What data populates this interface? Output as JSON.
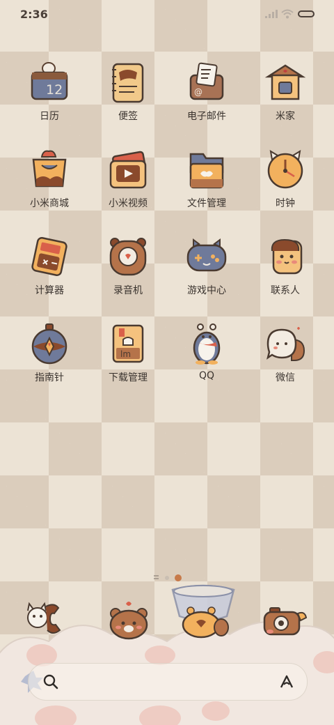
{
  "status_bar": {
    "time": "2:36"
  },
  "apps": [
    {
      "label": "日历",
      "icon": "calendar-icon",
      "day": "12"
    },
    {
      "label": "便签",
      "icon": "notes-icon"
    },
    {
      "label": "电子邮件",
      "icon": "email-icon"
    },
    {
      "label": "米家",
      "icon": "mijia-house-icon"
    },
    {
      "label": "小米商城",
      "icon": "mi-store-bag-icon"
    },
    {
      "label": "小米视频",
      "icon": "mi-video-icon"
    },
    {
      "label": "文件管理",
      "icon": "file-folder-icon"
    },
    {
      "label": "时钟",
      "icon": "clock-icon"
    },
    {
      "label": "计算器",
      "icon": "calculator-icon"
    },
    {
      "label": "录音机",
      "icon": "recorder-bear-icon"
    },
    {
      "label": "游戏中心",
      "icon": "game-controller-icon"
    },
    {
      "label": "联系人",
      "icon": "contacts-icon"
    },
    {
      "label": "指南针",
      "icon": "compass-icon"
    },
    {
      "label": "下载管理",
      "icon": "download-manager-icon"
    },
    {
      "label": "QQ",
      "icon": "qq-penguin-icon"
    },
    {
      "label": "微信",
      "icon": "wechat-bubble-icon"
    }
  ],
  "dock": [
    {
      "icon": "phone-cat-icon"
    },
    {
      "icon": "messages-bear-icon"
    },
    {
      "icon": "browser-bowl-icon"
    },
    {
      "icon": "camera-icon"
    }
  ],
  "colors": {
    "background_light": "#ece3d5",
    "background_dark": "#dbcdbc",
    "text": "#3a332e",
    "accent": "#c77a4a"
  }
}
